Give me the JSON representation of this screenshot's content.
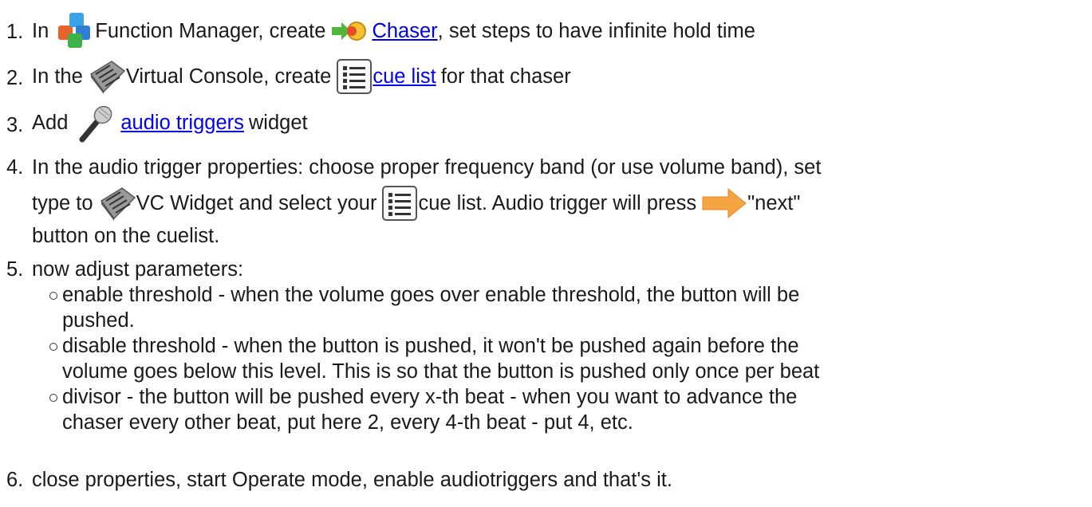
{
  "steps": [
    {
      "num": "1.",
      "pre": "In",
      "icon1": "function-manager-icon",
      "mid": "Function Manager, create",
      "icon2": "chaser-icon",
      "link": "Chaser",
      "post": ", set steps to have infinite hold time"
    },
    {
      "num": "2.",
      "pre": "In the",
      "icon1": "virtual-console-icon",
      "mid": "Virtual Console, create",
      "icon2": "cue-list-icon",
      "link": "cue list",
      "post": "for that chaser"
    },
    {
      "num": "3.",
      "pre": "Add",
      "icon1": "microphone-icon",
      "link": "audio triggers",
      "post": "widget"
    },
    {
      "num": "4.",
      "line1": "In the audio trigger properties: choose proper frequency band (or use volume band), set",
      "line2_pre": "type to",
      "line2_icon1": "virtual-console-icon",
      "line2_mid": "VC Widget and select your",
      "line2_icon2": "cue-list-icon",
      "line2_mid2": "cue list. Audio trigger will press",
      "line2_icon3": "next-arrow-icon",
      "line2_post": "\"next\"",
      "line3": "button on the cuelist."
    },
    {
      "num": "5.",
      "text": "now adjust parameters:",
      "bullets": [
        {
          "line1": "enable threshold - when the volume goes over enable threshold, the button will be",
          "line2": "pushed."
        },
        {
          "line1": "disable threshold - when the button is pushed, it won't be pushed again before the",
          "line2": "volume goes below this level. This is so that the button is pushed only once per beat"
        },
        {
          "line1": "divisor - the button will be pushed every x-th beat - when you want to advance the",
          "line2": "chaser every other beat, put here 2, every 4-th beat - put 4, etc."
        }
      ]
    },
    {
      "num": "6.",
      "text": "close properties, start Operate mode, enable audiotriggers and that's it."
    }
  ],
  "colors": {
    "link": "#0000ee",
    "text": "#1a1a1a",
    "arrow": "#f5a442"
  }
}
